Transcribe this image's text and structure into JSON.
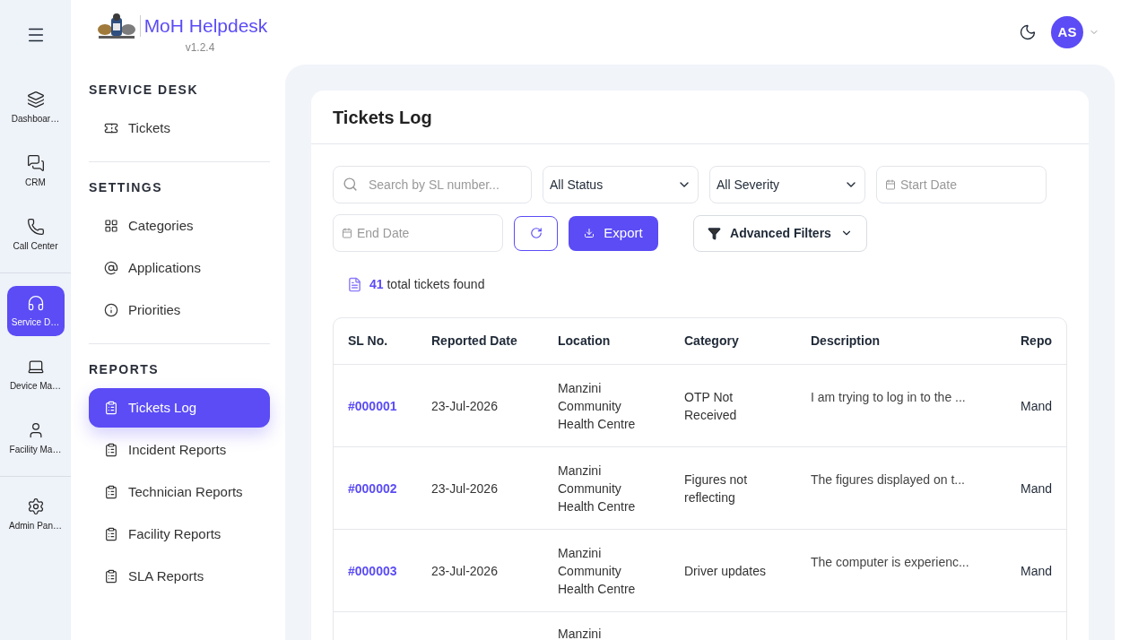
{
  "rail": [
    [
      {
        "label": "Dashboar…",
        "selected": false
      },
      {
        "label": "CRM",
        "selected": false
      },
      {
        "label": "Call Center",
        "selected": false
      }
    ],
    [
      {
        "label": "Service D…",
        "selected": true
      },
      {
        "label": "Device Ma…",
        "selected": false
      },
      {
        "label": "Facility Ma…",
        "selected": false
      }
    ],
    [
      {
        "label": "Admin Pan…",
        "selected": false
      }
    ]
  ],
  "brand": {
    "name": "MoH Helpdesk",
    "version": "v1.2.4"
  },
  "sidebar": [
    {
      "heading": "SERVICE DESK",
      "items": [
        {
          "label": "Tickets",
          "selected": false
        }
      ]
    },
    {
      "heading": "SETTINGS",
      "items": [
        {
          "label": "Categories",
          "selected": false
        },
        {
          "label": "Applications",
          "selected": false
        },
        {
          "label": "Priorities",
          "selected": false
        }
      ]
    },
    {
      "heading": "REPORTS",
      "items": [
        {
          "label": "Tickets Log",
          "selected": true
        },
        {
          "label": "Incident Reports",
          "selected": false
        },
        {
          "label": "Technician Reports",
          "selected": false
        },
        {
          "label": "Facility Reports",
          "selected": false
        },
        {
          "label": "SLA Reports",
          "selected": false
        }
      ]
    }
  ],
  "user": {
    "initials": "AS"
  },
  "card": {
    "title": "Tickets Log",
    "search": {
      "placeholder": "Search by SL number..."
    },
    "status_select": "All Status",
    "severity_select": "All Severity",
    "start_date": {
      "placeholder": "Start Date"
    },
    "end_date": {
      "placeholder": "End Date"
    },
    "export_button": "Export",
    "advanced_filters": "Advanced Filters",
    "count": "41",
    "count_label": "total tickets found",
    "table": {
      "columns": [
        "SL No.",
        "Reported Date",
        "Location",
        "Category",
        "Description",
        "Repo"
      ],
      "rows": [
        [
          "#000001",
          "23-Jul-2026",
          "Manzini Community Health Centre",
          "OTP Not Received",
          "I am trying to log in to the ...",
          "Mand"
        ],
        [
          "#000002",
          "23-Jul-2026",
          "Manzini Community Health Centre",
          "Figures not reflecting",
          "The figures displayed on t...",
          "Mand"
        ],
        [
          "#000003",
          "23-Jul-2026",
          "Manzini Community Health Centre",
          "Driver updates",
          "The computer is experienc...",
          "Mand"
        ],
        [
          "",
          "",
          "Manzini",
          "",
          "",
          ""
        ]
      ]
    }
  }
}
